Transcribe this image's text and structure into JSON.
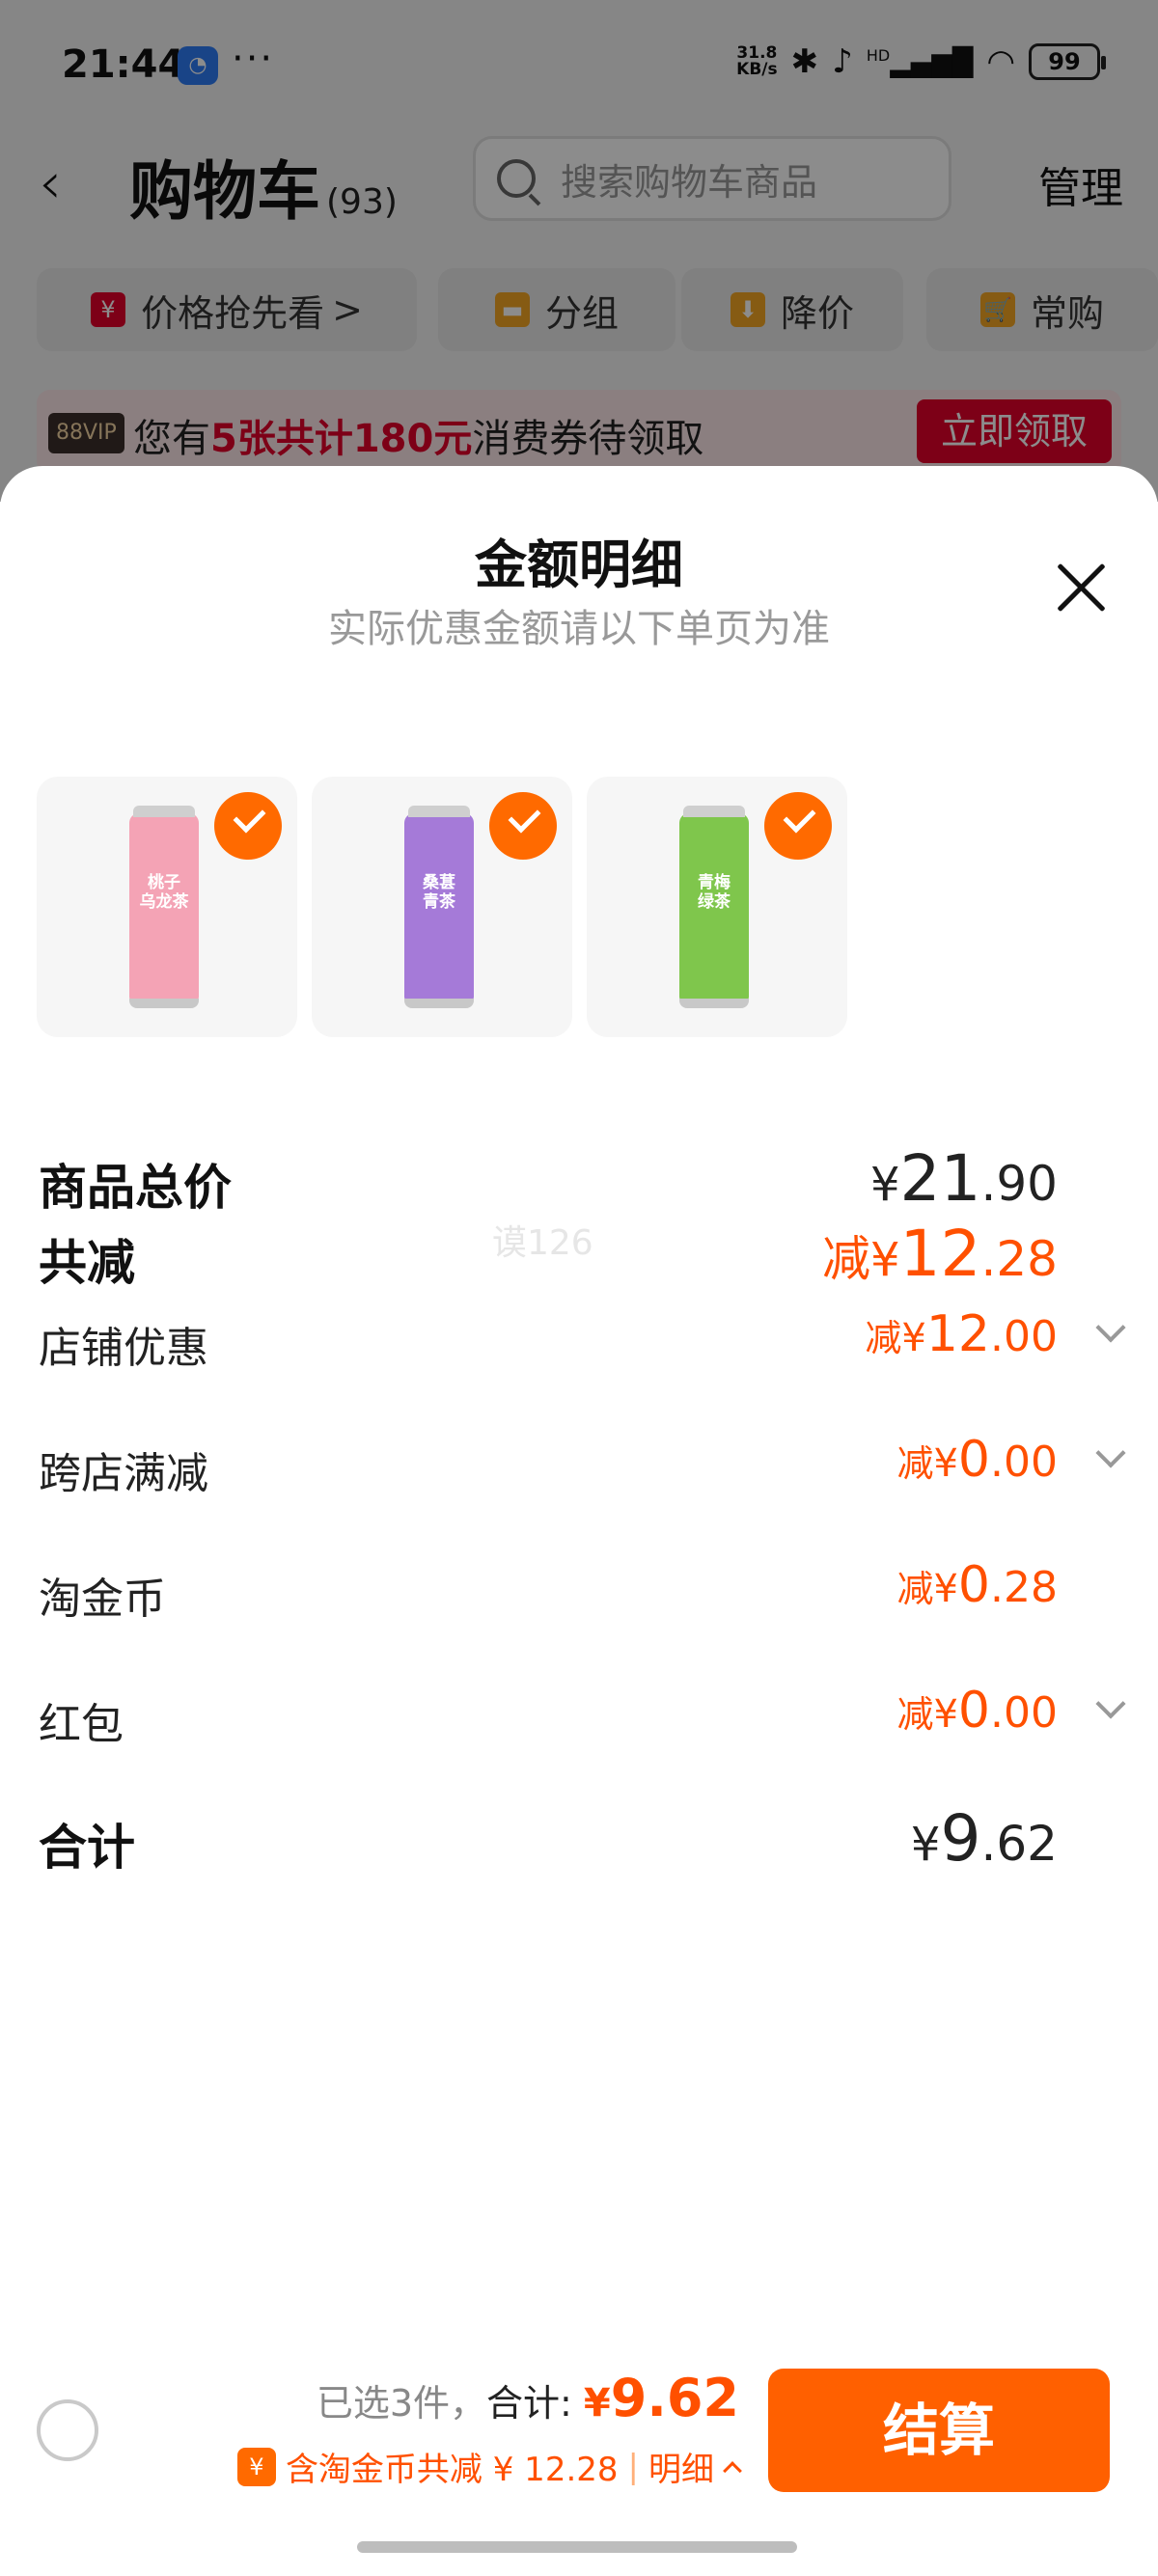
{
  "status_bar": {
    "time": "21:44",
    "app_icon": "browser-icon",
    "dots": "···",
    "net_speed_value": "31.8",
    "net_speed_unit": "KB/s",
    "signal_label": "HD",
    "battery": "99"
  },
  "cart": {
    "title": "购物车",
    "count": "(93)",
    "search_placeholder": "搜索购物车商品",
    "manage_label": "管理",
    "chips": [
      {
        "label": "价格抢先看",
        "suffix": ">",
        "icon": "price-tag-icon",
        "icon_color": "#e4002b"
      },
      {
        "label": "分组",
        "icon": "folder-icon",
        "icon_color": "#f5a623"
      },
      {
        "label": "降价",
        "icon": "price-drop-icon",
        "icon_color": "#f5a623"
      },
      {
        "label": "常购",
        "icon": "cart-plus-icon",
        "icon_color": "#f5a623"
      }
    ],
    "promo": {
      "badge": "88VIP",
      "text_prefix": "您有",
      "text_highlight": "5张共计180元",
      "text_suffix": "消费券待领取",
      "button": "立即领取"
    }
  },
  "sheet": {
    "title": "金额明细",
    "subtitle": "实际优惠金额请以下单页为准",
    "watermark": "谟126",
    "products": [
      {
        "name": "桃子乌龙茶",
        "label_line1": "桃子",
        "label_line2": "乌龙茶",
        "color": "#f4a3b5",
        "checked": true
      },
      {
        "name": "桑葚青茶",
        "label_line1": "桑葚",
        "label_line2": "青茶",
        "color": "#a57ad8",
        "checked": true
      },
      {
        "name": "青梅绿茶",
        "label_line1": "青梅",
        "label_line2": "绿茶",
        "color": "#7fc64c",
        "checked": true
      }
    ],
    "rows": [
      {
        "label": "商品总价",
        "prefix": "",
        "currency": "¥",
        "int": "21",
        "dec": ".90"
      },
      {
        "label": "共减",
        "prefix": "减",
        "currency": "¥",
        "int": "12",
        "dec": ".28"
      },
      {
        "label": "店铺优惠",
        "prefix": "减",
        "currency": "¥",
        "int": "12",
        "dec": ".00"
      },
      {
        "label": "跨店满减",
        "prefix": "减",
        "currency": "¥",
        "int": "0",
        "dec": ".00"
      },
      {
        "label": "淘金币",
        "prefix": "减",
        "currency": "¥",
        "int": "0",
        "dec": ".28"
      },
      {
        "label": "红包",
        "prefix": "减",
        "currency": "¥",
        "int": "0",
        "dec": ".00"
      },
      {
        "label": "合计",
        "prefix": "",
        "currency": "¥",
        "int": "9",
        "dec": ".62"
      }
    ]
  },
  "bottom": {
    "selected_text": "已选3件，",
    "total_label": "合计: ",
    "currency": "¥",
    "total_value": "9.62",
    "coin_icon": "¥",
    "discount_text": "含淘金币共减 ¥ 12.28",
    "divider": "|",
    "detail_label": "明细",
    "checkout_label": "结算"
  },
  "colors": {
    "accent": "#ff5000",
    "checkout": "#ff6000",
    "promo_red": "#e4002b"
  }
}
